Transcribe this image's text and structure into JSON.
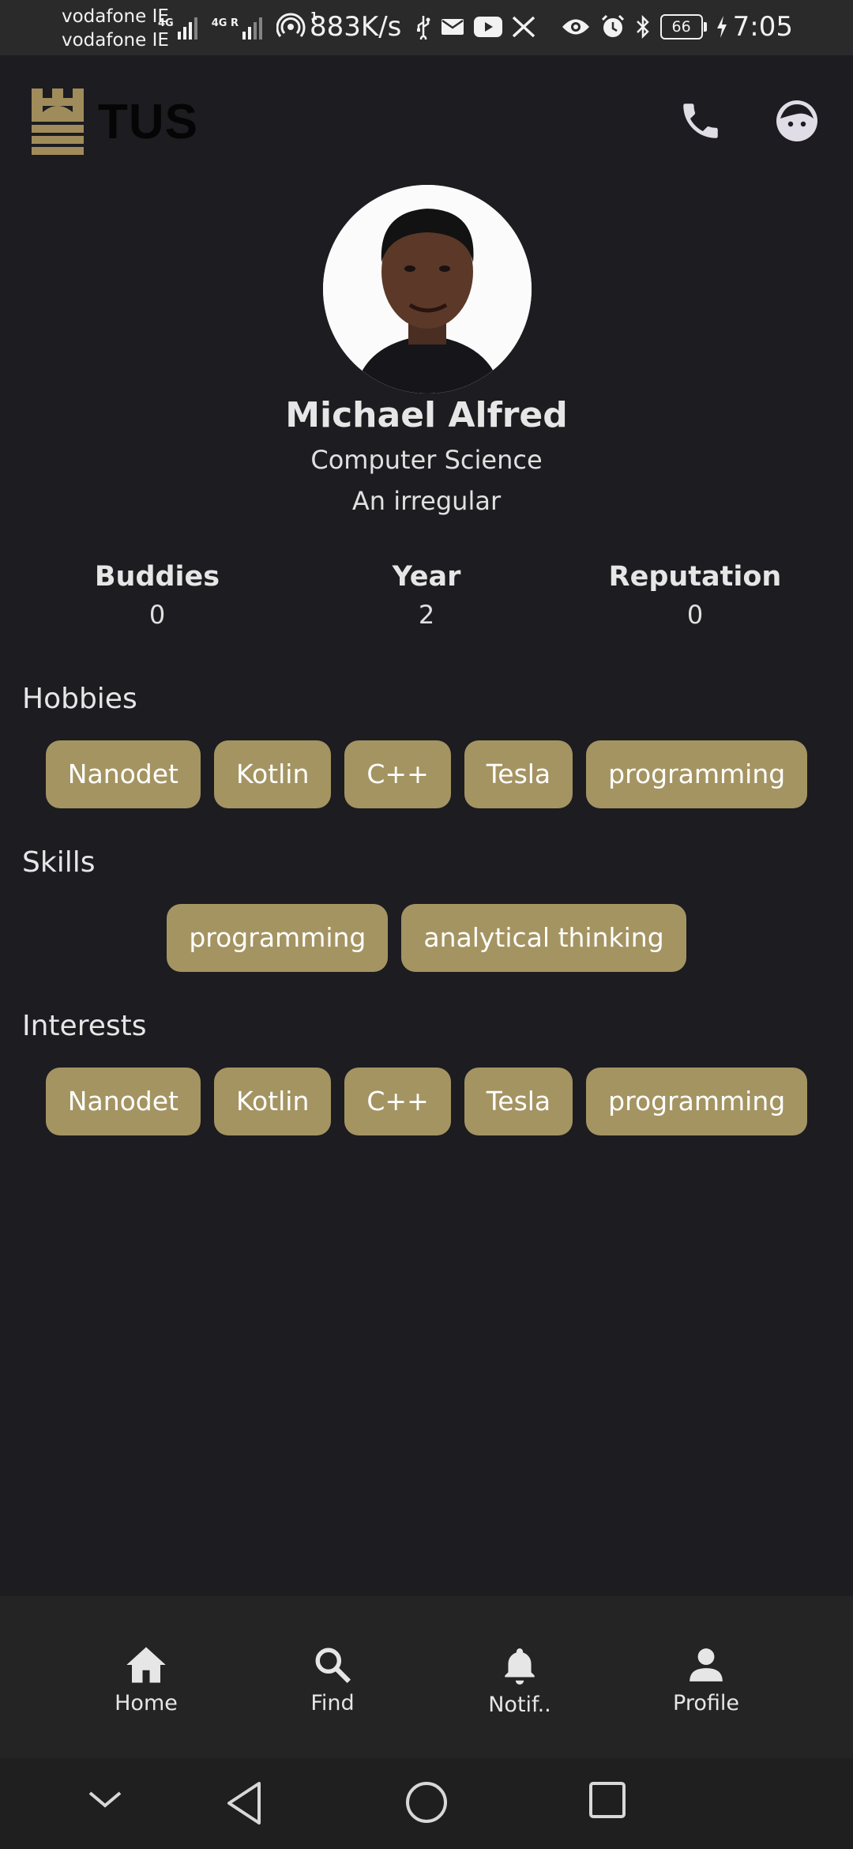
{
  "status_bar": {
    "carrier_1": "vodafone IE",
    "carrier_2": "vodafone IE",
    "network_1": "4G",
    "network_2": "4G R",
    "hotspot_count": "1",
    "speed": "883K/s",
    "battery": "66",
    "time": "7:05"
  },
  "header": {
    "logo_text": "TUS",
    "call_icon": "phone-icon",
    "avatar_icon": "face-icon"
  },
  "profile": {
    "name": "Michael Alfred",
    "course": "Computer Science",
    "tagline": "An irregular",
    "stats": [
      {
        "label": "Buddies",
        "value": "0"
      },
      {
        "label": "Year",
        "value": "2"
      },
      {
        "label": "Reputation",
        "value": "0"
      }
    ]
  },
  "sections": {
    "hobbies": {
      "title": "Hobbies",
      "chips": [
        "Nanodet",
        "Kotlin",
        "C++",
        "Tesla",
        "programming"
      ]
    },
    "skills": {
      "title": "Skills",
      "chips": [
        "programming",
        "analytical thinking"
      ]
    },
    "interests": {
      "title": "Interests",
      "chips": [
        "Nanodet",
        "Kotlin",
        "C++",
        "Tesla",
        "programming"
      ]
    }
  },
  "bottom_nav": {
    "items": [
      {
        "label": "Home",
        "icon": "home-icon"
      },
      {
        "label": "Find",
        "icon": "search-icon"
      },
      {
        "label": "Notif..",
        "icon": "bell-icon"
      },
      {
        "label": "Profile",
        "icon": "person-icon"
      }
    ]
  },
  "colors": {
    "background": "#1c1c21",
    "chip": "#a49462",
    "logo_gold": "#a08c5b",
    "nav_bar": "#242424"
  }
}
